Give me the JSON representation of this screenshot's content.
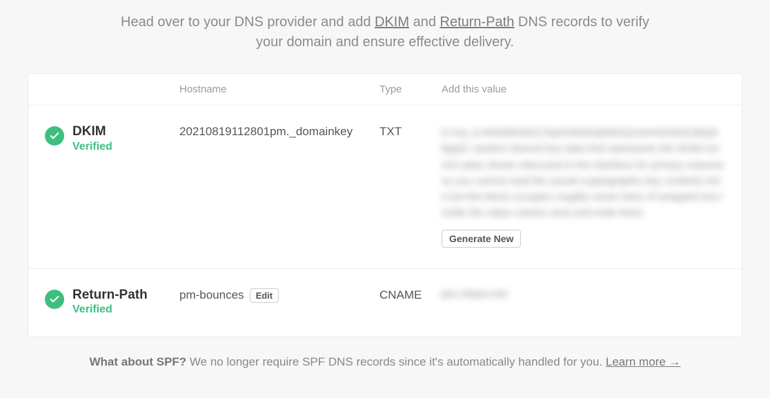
{
  "intro": {
    "prefix": "Head over to your DNS provider and add ",
    "link1": "DKIM",
    "mid": " and ",
    "link2": "Return-Path",
    "suffix": " DNS records to verify your domain and ensure effective delivery."
  },
  "headers": {
    "hostname": "Hostname",
    "type": "Type",
    "value": "Add this value"
  },
  "records": {
    "dkim": {
      "name": "DKIM",
      "status": "Verified",
      "hostname": "20210819112801pm._domainkey",
      "type": "TXT",
      "value_blurred": "k=rsa; p=MIGfMA0GCSqGSIb3DQEBAQUAA4GNADCBiQKBgQC random blurred key data that represents the DKIM record value shown obscured in the interface for privacy reasons so you cannot read the actual cryptographic key contents here but the block occupies roughly seven lines of wrapped text inside the value column area and ends there",
      "generate_label": "Generate New"
    },
    "return_path": {
      "name": "Return-Path",
      "status": "Verified",
      "hostname": "pm-bounces",
      "edit_label": "Edit",
      "type": "CNAME",
      "value_blurred": "pm.mtasv.net"
    }
  },
  "footer": {
    "strong": "What about SPF?",
    "text": " We no longer require SPF DNS records since it's automatically handled for you. ",
    "learn": "Learn more →"
  }
}
